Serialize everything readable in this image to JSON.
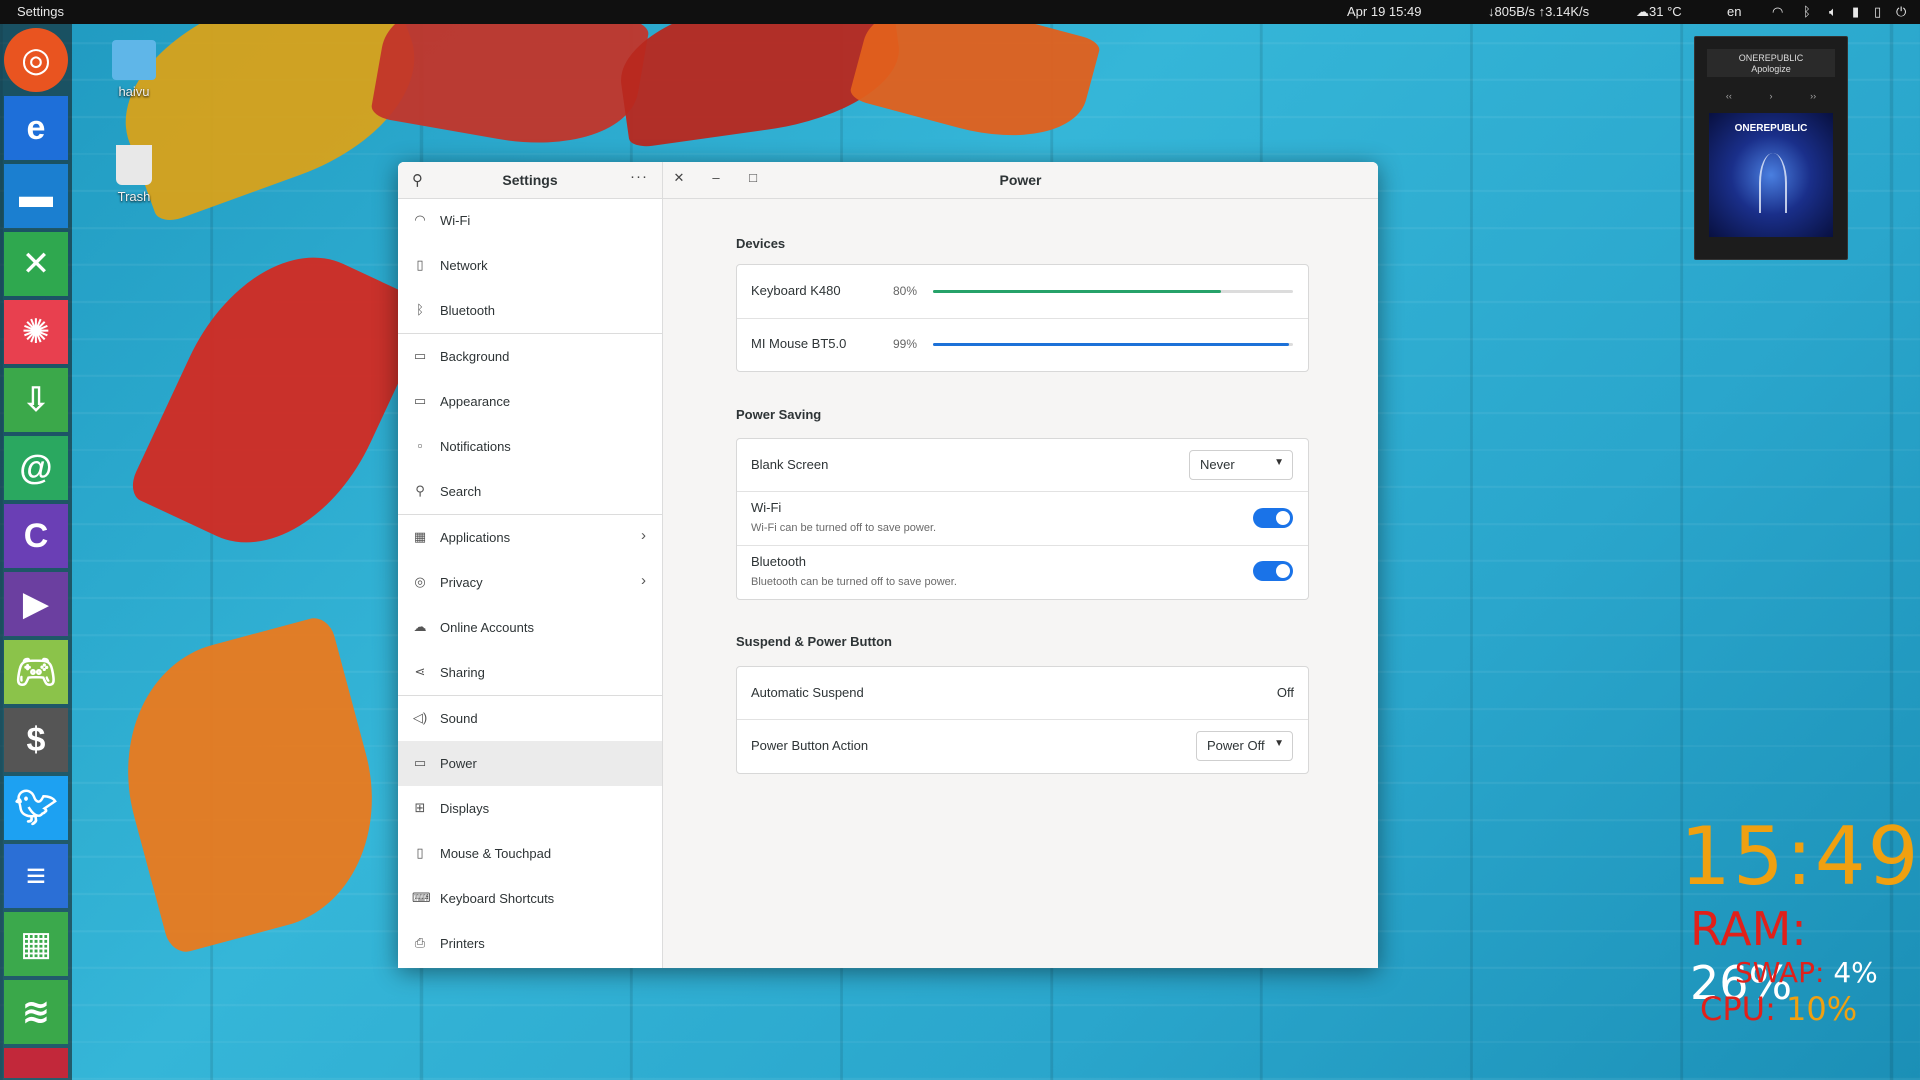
{
  "topbar": {
    "app_name": "Settings",
    "datetime": "Apr 19  15:49",
    "net_speed": "↓805B/s ↑3.14K/s",
    "weather": "☁31 °C",
    "lang": "en"
  },
  "desktop": {
    "folder_label": "haivu",
    "trash_label": "Trash"
  },
  "sidebar": {
    "title": "Settings",
    "items": [
      {
        "label": "Wi-Fi",
        "icon": "wifi-icon"
      },
      {
        "label": "Network",
        "icon": "network-icon"
      },
      {
        "label": "Bluetooth",
        "icon": "bluetooth-icon"
      },
      {
        "label": "Background",
        "icon": "background-icon"
      },
      {
        "label": "Appearance",
        "icon": "appearance-icon"
      },
      {
        "label": "Notifications",
        "icon": "notifications-icon"
      },
      {
        "label": "Search",
        "icon": "search-icon"
      },
      {
        "label": "Applications",
        "icon": "applications-icon"
      },
      {
        "label": "Privacy",
        "icon": "privacy-icon"
      },
      {
        "label": "Online Accounts",
        "icon": "cloud-icon"
      },
      {
        "label": "Sharing",
        "icon": "share-icon"
      },
      {
        "label": "Sound",
        "icon": "sound-icon"
      },
      {
        "label": "Power",
        "icon": "power-icon"
      },
      {
        "label": "Displays",
        "icon": "displays-icon"
      },
      {
        "label": "Mouse & Touchpad",
        "icon": "mouse-icon"
      },
      {
        "label": "Keyboard Shortcuts",
        "icon": "keyboard-icon"
      },
      {
        "label": "Printers",
        "icon": "printer-icon"
      }
    ]
  },
  "main": {
    "title": "Power",
    "devices_heading": "Devices",
    "devices": [
      {
        "name": "Keyboard K480",
        "percent": "80%",
        "level": 0.8,
        "color": "#26a269"
      },
      {
        "name": "MI Mouse BT5.0",
        "percent": "99%",
        "level": 0.99,
        "color": "#1c71d8"
      }
    ],
    "power_saving_heading": "Power Saving",
    "blank_screen_label": "Blank Screen",
    "blank_screen_value": "Never",
    "wifi_label": "Wi-Fi",
    "wifi_sub": "Wi-Fi can be turned off to save power.",
    "bluetooth_label": "Bluetooth",
    "bluetooth_sub": "Bluetooth can be turned off to save power.",
    "suspend_heading": "Suspend & Power Button",
    "auto_suspend_label": "Automatic Suspend",
    "auto_suspend_value": "Off",
    "power_button_label": "Power Button Action",
    "power_button_value": "Power Off"
  },
  "music": {
    "artist": "ONEREPUBLIC",
    "track": "Apologize",
    "album_band": "ONEREPUBLIC"
  },
  "conky": {
    "time": "15:49",
    "ram_label": "RAM:",
    "ram_value": "26%",
    "swap_label": "SWAP:",
    "swap_value": "4%",
    "cpu_label": "CPU:",
    "cpu_value": "10%"
  }
}
